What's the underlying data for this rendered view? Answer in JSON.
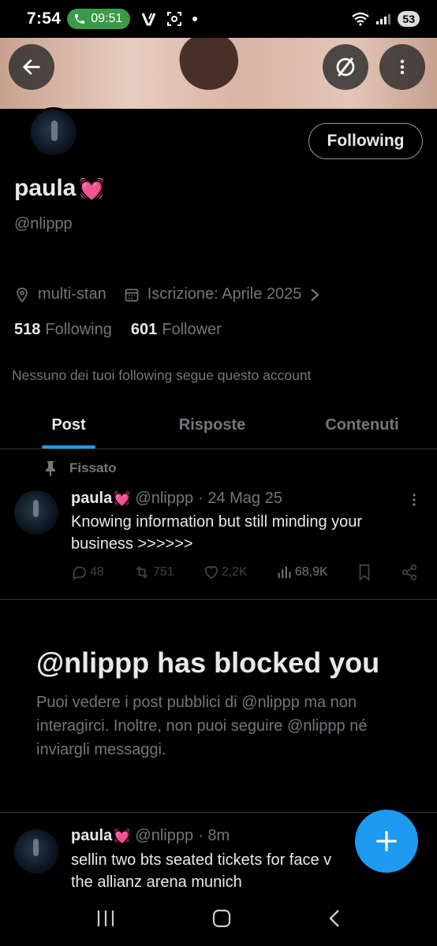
{
  "status_bar": {
    "time": "7:54",
    "call_timer": "09:51",
    "battery": "53",
    "signal_label": "5"
  },
  "header": {
    "back_icon": "arrow-left-icon",
    "grok_icon": "slash-circle-icon",
    "more_icon": "vertical-dots-icon"
  },
  "profile": {
    "display_name": "paula",
    "name_emoji": "💓",
    "handle": "@nlippp",
    "follow_button_label": "Following",
    "location": "multi-stan",
    "joined": "Iscrizione: Aprile 2025",
    "following_count": "518",
    "following_label": "Following",
    "followers_count": "601",
    "followers_label": "Follower",
    "followed_by_note": "Nessuno dei tuoi following segue questo account"
  },
  "tabs": [
    {
      "label": "Post",
      "active": true
    },
    {
      "label": "Risposte",
      "active": false
    },
    {
      "label": "Contenuti",
      "active": false
    }
  ],
  "pinned_post": {
    "pinned_label": "Fissato",
    "author_name": "paula",
    "author_emoji": "💓",
    "handle": "@nlippp",
    "date": "· 24 Mag 25",
    "text": "Knowing information but still minding your business >>>>>>",
    "replies": "48",
    "reposts": "751",
    "likes": "2,2K",
    "views": "68,9K"
  },
  "blocked_notice": {
    "title": "@nlippp has blocked you",
    "description": "Puoi vedere i post pubblici di @nlippp ma non interagirci. Inoltre, non puoi seguire @nlippp né inviargli messaggi."
  },
  "second_post": {
    "author_name": "paula",
    "author_emoji": "💓",
    "handle": "@nlippp",
    "time": "· 8m",
    "text_line1": "sellin two bts seated tickets for face v",
    "text_line1_end": "t",
    "text_line2": "the allianz arena munich"
  },
  "colors": {
    "accent": "#1d9bf0",
    "background": "#000000",
    "primary_text": "#e7e9ea",
    "secondary_text": "#71767b",
    "divider": "#2f3336"
  }
}
